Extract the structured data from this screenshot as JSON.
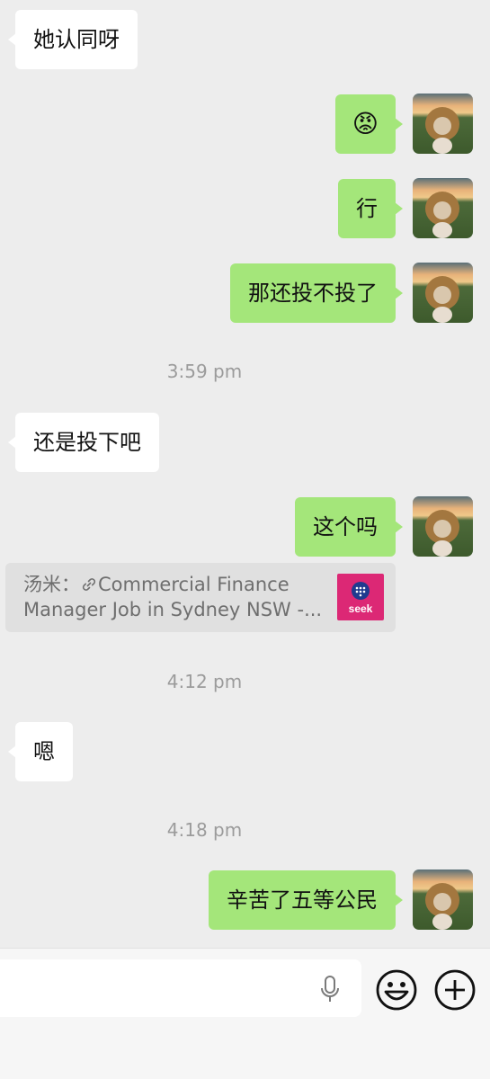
{
  "messages": [
    {
      "side": "in",
      "text": "她认同呀"
    },
    {
      "side": "out",
      "text": "😡"
    },
    {
      "side": "out",
      "text": "行"
    },
    {
      "side": "out",
      "text": "那还投不投了"
    },
    {
      "side": "in",
      "text": "还是投下吧"
    },
    {
      "side": "out",
      "text": "这个吗"
    },
    {
      "side": "in",
      "text": "嗯"
    },
    {
      "side": "out",
      "text": "辛苦了五等公民"
    }
  ],
  "timestamps": [
    "3:59 pm",
    "4:12 pm",
    "4:18 pm"
  ],
  "quote": {
    "author": "汤米：",
    "line1": "Commercial Finance",
    "line2": "Manager Job in Sydney NSW -...",
    "logo_text": "seek",
    "logo_color": "#dc2875"
  },
  "icons": {
    "link": "link-icon",
    "mic": "microphone-icon",
    "emoji": "emoji-icon",
    "plus": "plus-icon"
  },
  "colors": {
    "background": "#ededed",
    "incoming_bubble": "#ffffff",
    "outgoing_bubble": "#a4e67a",
    "timestamp": "#9b9b9b"
  }
}
